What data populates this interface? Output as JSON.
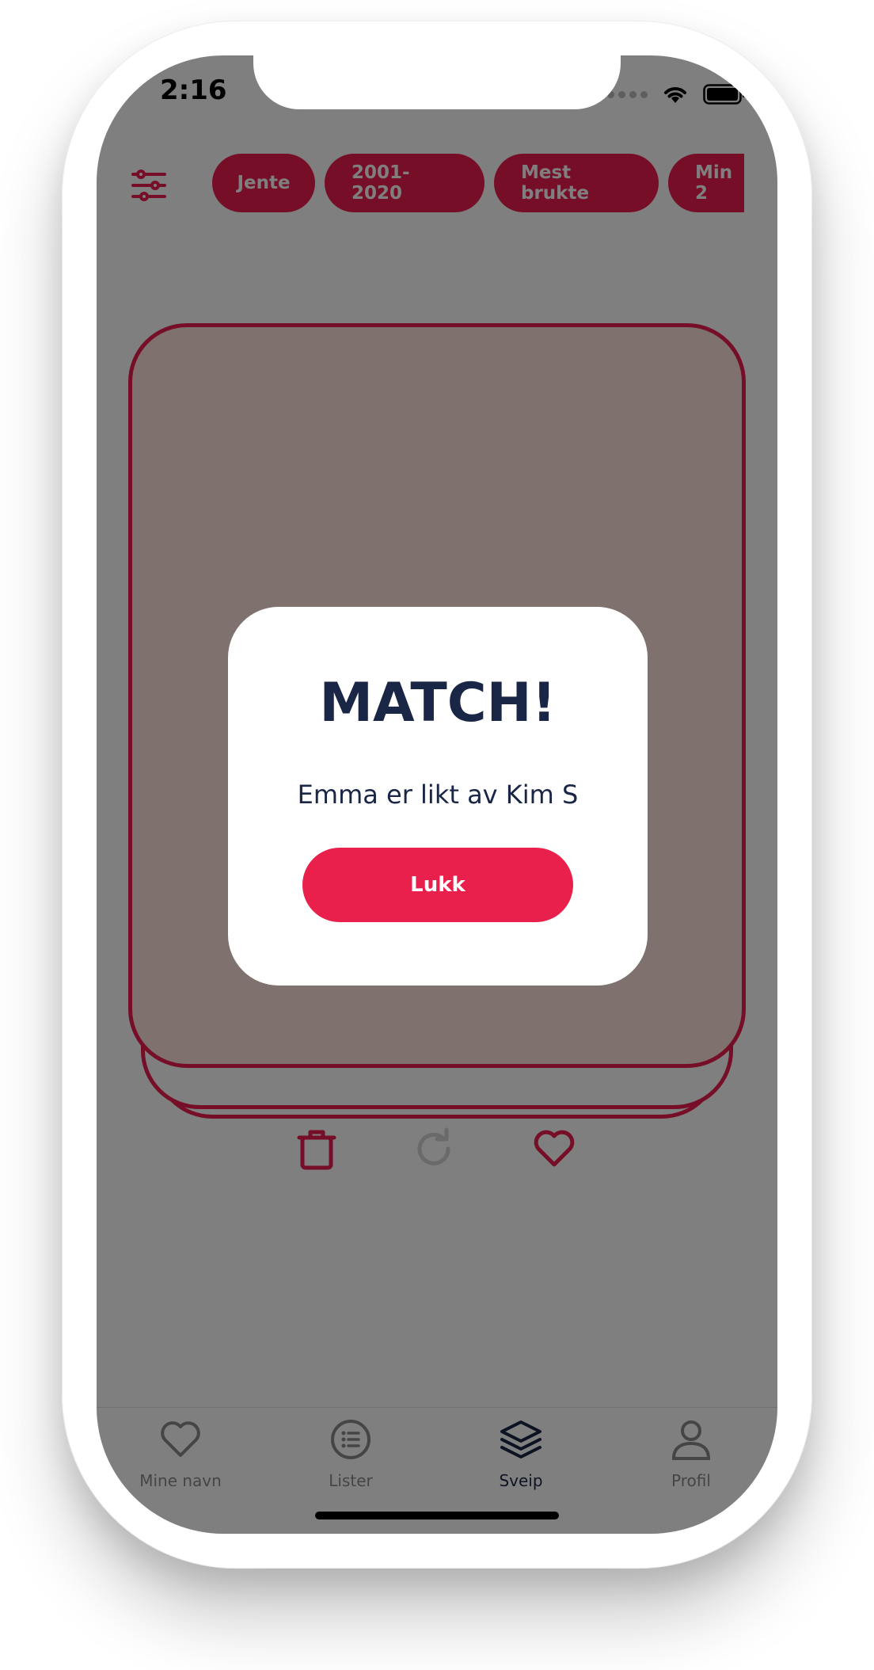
{
  "status_bar": {
    "time": "2:16"
  },
  "filters": {
    "icon": "sliders-icon",
    "chips": [
      "Jente",
      "2001-2020",
      "Mest brukte",
      "Min 2"
    ]
  },
  "colors": {
    "accent": "#ee1d4e",
    "button": "#e8204b",
    "text_dark": "#1a2646",
    "card_fill": "#fde2dc"
  },
  "card_actions": {
    "delete": "trash-icon",
    "undo": "refresh-icon",
    "like": "heart-icon"
  },
  "modal": {
    "title": "MATCH!",
    "message": "Emma er likt av Kim S",
    "button_label": "Lukk"
  },
  "tabbar": {
    "items": [
      {
        "label": "Mine navn",
        "icon": "heart-icon",
        "active": false
      },
      {
        "label": "Lister",
        "icon": "list-icon",
        "active": false
      },
      {
        "label": "Sveip",
        "icon": "layers-icon",
        "active": true
      },
      {
        "label": "Profil",
        "icon": "user-icon",
        "active": false
      }
    ]
  }
}
